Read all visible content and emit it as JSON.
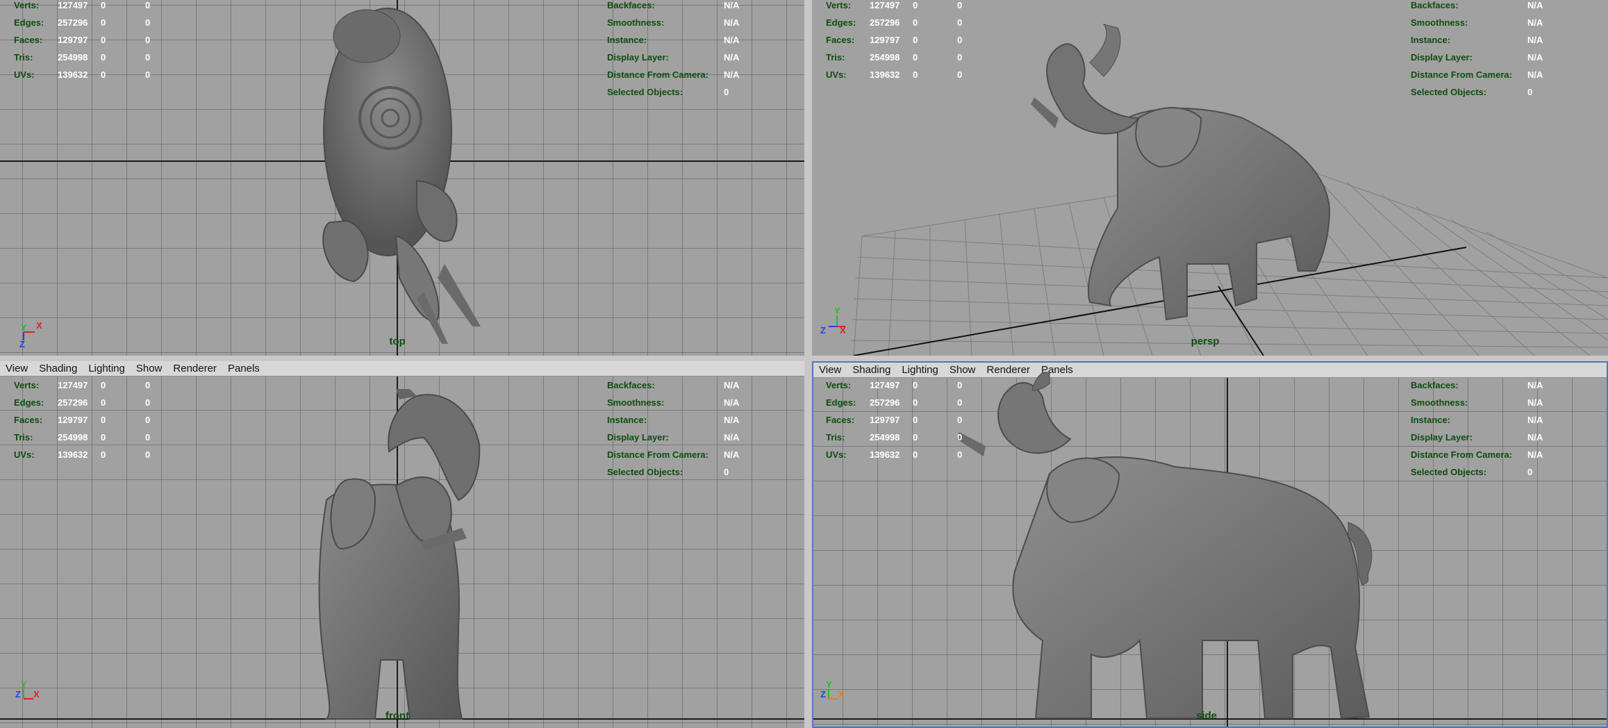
{
  "stats": {
    "left_rows": [
      {
        "label": "Verts:",
        "v1": "127497",
        "v2": "0",
        "v3": "0"
      },
      {
        "label": "Edges:",
        "v1": "257296",
        "v2": "0",
        "v3": "0"
      },
      {
        "label": "Faces:",
        "v1": "129797",
        "v2": "0",
        "v3": "0"
      },
      {
        "label": "Tris:",
        "v1": "254998",
        "v2": "0",
        "v3": "0"
      },
      {
        "label": "UVs:",
        "v1": "139632",
        "v2": "0",
        "v3": "0"
      }
    ],
    "right_rows": [
      {
        "label": "Backfaces:",
        "value": "N/A"
      },
      {
        "label": "Smoothness:",
        "value": "N/A"
      },
      {
        "label": "Instance:",
        "value": "N/A"
      },
      {
        "label": "Display Layer:",
        "value": "N/A"
      },
      {
        "label": "Distance From Camera:",
        "value": "N/A"
      },
      {
        "label": "Selected Objects:",
        "value": "0"
      }
    ]
  },
  "menu": {
    "view": "View",
    "shading": "Shading",
    "lighting": "Lighting",
    "show": "Show",
    "renderer": "Renderer",
    "panels": "Panels"
  },
  "viewports": {
    "top": {
      "camera": "top"
    },
    "persp": {
      "camera": "persp"
    },
    "front": {
      "camera": "front"
    },
    "side": {
      "camera": "side"
    }
  },
  "axes": {
    "x": "X",
    "y": "Y",
    "z": "Z",
    "x_color": "#e02020",
    "y_color": "#20c020",
    "z_color": "#2040ff"
  },
  "colors": {
    "viewport_bg": "#a1a1a1",
    "hud_label": "#0d4d0d",
    "hud_value": "#ffffff",
    "active_border": "#4f78b8",
    "model": "#6e6e6e"
  },
  "model": {
    "name": "elephant-model"
  }
}
